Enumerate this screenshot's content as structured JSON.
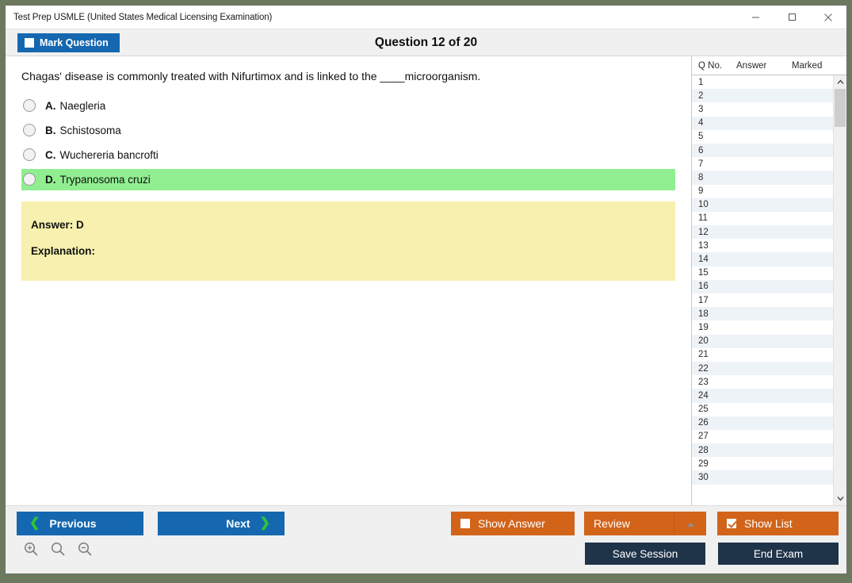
{
  "window": {
    "title": "Test Prep USMLE (United States Medical Licensing Examination)",
    "controls": {
      "minimize": "minimize-icon",
      "maximize": "maximize-icon",
      "close": "close-icon"
    }
  },
  "toolbar": {
    "mark_question_label": "Mark Question",
    "mark_question_checked": false,
    "question_counter": "Question 12 of 20"
  },
  "question": {
    "text": "Chagas' disease is commonly treated with Nifurtimox and is linked to the ____microorganism.",
    "options": [
      {
        "letter": "A.",
        "text": "Naegleria",
        "selected": false,
        "highlighted": false
      },
      {
        "letter": "B.",
        "text": "Schistosoma",
        "selected": false,
        "highlighted": false
      },
      {
        "letter": "C.",
        "text": "Wuchereria bancrofti",
        "selected": false,
        "highlighted": false
      },
      {
        "letter": "D.",
        "text": "Trypanosoma cruzi",
        "selected": false,
        "highlighted": true
      }
    ]
  },
  "answer_panel": {
    "answer_label": "Answer: D",
    "explanation_label": "Explanation:"
  },
  "question_list": {
    "columns": [
      "Q No.",
      "Answer",
      "Marked"
    ],
    "rows": [
      {
        "qno": "1",
        "answer": "",
        "marked": ""
      },
      {
        "qno": "2",
        "answer": "",
        "marked": ""
      },
      {
        "qno": "3",
        "answer": "",
        "marked": ""
      },
      {
        "qno": "4",
        "answer": "",
        "marked": ""
      },
      {
        "qno": "5",
        "answer": "",
        "marked": ""
      },
      {
        "qno": "6",
        "answer": "",
        "marked": ""
      },
      {
        "qno": "7",
        "answer": "",
        "marked": ""
      },
      {
        "qno": "8",
        "answer": "",
        "marked": ""
      },
      {
        "qno": "9",
        "answer": "",
        "marked": ""
      },
      {
        "qno": "10",
        "answer": "",
        "marked": ""
      },
      {
        "qno": "11",
        "answer": "",
        "marked": ""
      },
      {
        "qno": "12",
        "answer": "",
        "marked": ""
      },
      {
        "qno": "13",
        "answer": "",
        "marked": ""
      },
      {
        "qno": "14",
        "answer": "",
        "marked": ""
      },
      {
        "qno": "15",
        "answer": "",
        "marked": ""
      },
      {
        "qno": "16",
        "answer": "",
        "marked": ""
      },
      {
        "qno": "17",
        "answer": "",
        "marked": ""
      },
      {
        "qno": "18",
        "answer": "",
        "marked": ""
      },
      {
        "qno": "19",
        "answer": "",
        "marked": ""
      },
      {
        "qno": "20",
        "answer": "",
        "marked": ""
      },
      {
        "qno": "21",
        "answer": "",
        "marked": ""
      },
      {
        "qno": "22",
        "answer": "",
        "marked": ""
      },
      {
        "qno": "23",
        "answer": "",
        "marked": ""
      },
      {
        "qno": "24",
        "answer": "",
        "marked": ""
      },
      {
        "qno": "25",
        "answer": "",
        "marked": ""
      },
      {
        "qno": "26",
        "answer": "",
        "marked": ""
      },
      {
        "qno": "27",
        "answer": "",
        "marked": ""
      },
      {
        "qno": "28",
        "answer": "",
        "marked": ""
      },
      {
        "qno": "29",
        "answer": "",
        "marked": ""
      },
      {
        "qno": "30",
        "answer": "",
        "marked": ""
      }
    ],
    "scroll_up_icon": "chevron-up-icon",
    "scroll_down_icon": "chevron-down-icon"
  },
  "bottom_bar": {
    "previous_label": "Previous",
    "next_label": "Next",
    "show_answer_label": "Show Answer",
    "show_answer_checked": false,
    "review_label": "Review",
    "show_list_label": "Show List",
    "show_list_checked": true,
    "save_session_label": "Save Session",
    "end_exam_label": "End Exam",
    "zoom_in_icon": "zoom-in-icon",
    "zoom_reset_icon": "zoom-icon",
    "zoom_out_icon": "zoom-out-icon"
  },
  "colors": {
    "primary_blue": "#1568b0",
    "orange": "#d2641a",
    "dark_navy": "#1f3349",
    "correct_green": "#90ee90",
    "answer_yellow": "#f7f0ae",
    "chevron_green": "#2fc72f"
  }
}
